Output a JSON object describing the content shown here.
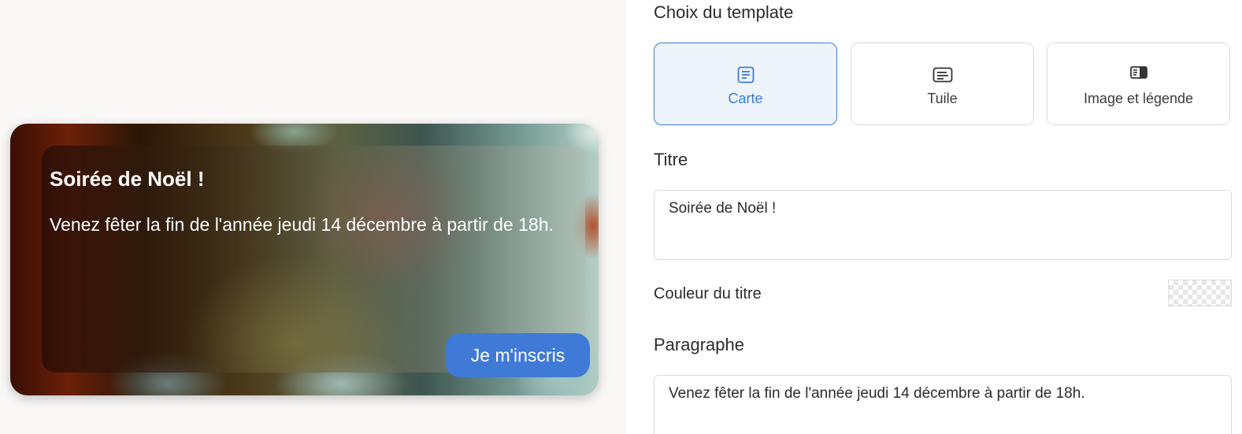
{
  "preview": {
    "card": {
      "title": "Soirée de Noël !",
      "paragraph": "Venez fêter la fin de l'année jeudi 14 décembre à partir de 18h.",
      "cta_label": "Je m'inscris"
    }
  },
  "form": {
    "template_section_label": "Choix du template",
    "templates": [
      {
        "label": "Carte",
        "icon": "card-template-icon",
        "selected": true
      },
      {
        "label": "Tuile",
        "icon": "tile-template-icon",
        "selected": false
      },
      {
        "label": "Image et légende",
        "icon": "image-caption-template-icon",
        "selected": false
      }
    ],
    "title_section_label": "Titre",
    "title_value": "Soirée de Noël !",
    "title_color_label": "Couleur du titre",
    "paragraph_section_label": "Paragraphe",
    "paragraph_value": "Venez fêter la fin de l'année jeudi 14 décembre à partir de 18h."
  },
  "colors": {
    "accent": "#3f7ad6",
    "selected_bg": "#eef4fc",
    "border": "#dcdcdc"
  }
}
